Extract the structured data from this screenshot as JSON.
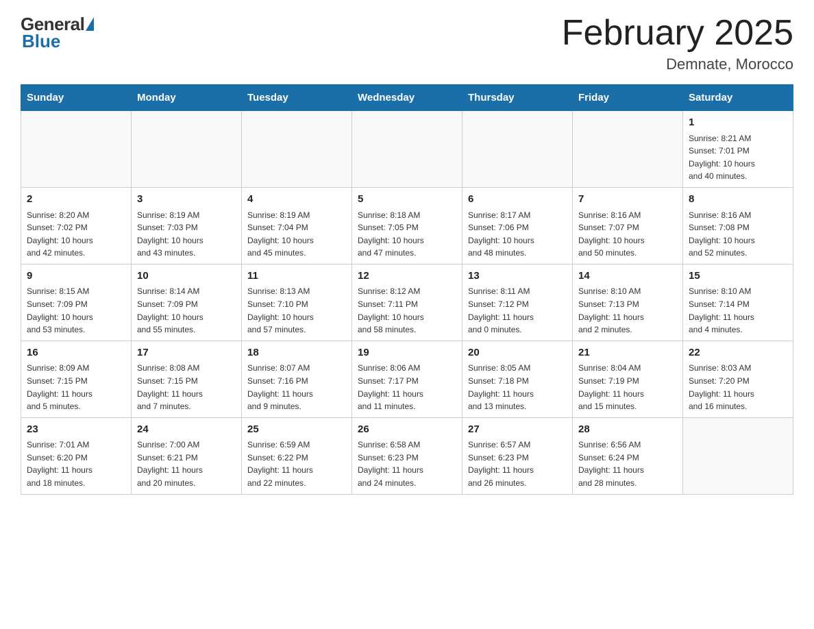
{
  "logo": {
    "general": "General",
    "blue": "Blue"
  },
  "title": "February 2025",
  "subtitle": "Demnate, Morocco",
  "weekdays": [
    "Sunday",
    "Monday",
    "Tuesday",
    "Wednesday",
    "Thursday",
    "Friday",
    "Saturday"
  ],
  "weeks": [
    [
      {
        "day": "",
        "info": ""
      },
      {
        "day": "",
        "info": ""
      },
      {
        "day": "",
        "info": ""
      },
      {
        "day": "",
        "info": ""
      },
      {
        "day": "",
        "info": ""
      },
      {
        "day": "",
        "info": ""
      },
      {
        "day": "1",
        "info": "Sunrise: 8:21 AM\nSunset: 7:01 PM\nDaylight: 10 hours\nand 40 minutes."
      }
    ],
    [
      {
        "day": "2",
        "info": "Sunrise: 8:20 AM\nSunset: 7:02 PM\nDaylight: 10 hours\nand 42 minutes."
      },
      {
        "day": "3",
        "info": "Sunrise: 8:19 AM\nSunset: 7:03 PM\nDaylight: 10 hours\nand 43 minutes."
      },
      {
        "day": "4",
        "info": "Sunrise: 8:19 AM\nSunset: 7:04 PM\nDaylight: 10 hours\nand 45 minutes."
      },
      {
        "day": "5",
        "info": "Sunrise: 8:18 AM\nSunset: 7:05 PM\nDaylight: 10 hours\nand 47 minutes."
      },
      {
        "day": "6",
        "info": "Sunrise: 8:17 AM\nSunset: 7:06 PM\nDaylight: 10 hours\nand 48 minutes."
      },
      {
        "day": "7",
        "info": "Sunrise: 8:16 AM\nSunset: 7:07 PM\nDaylight: 10 hours\nand 50 minutes."
      },
      {
        "day": "8",
        "info": "Sunrise: 8:16 AM\nSunset: 7:08 PM\nDaylight: 10 hours\nand 52 minutes."
      }
    ],
    [
      {
        "day": "9",
        "info": "Sunrise: 8:15 AM\nSunset: 7:09 PM\nDaylight: 10 hours\nand 53 minutes."
      },
      {
        "day": "10",
        "info": "Sunrise: 8:14 AM\nSunset: 7:09 PM\nDaylight: 10 hours\nand 55 minutes."
      },
      {
        "day": "11",
        "info": "Sunrise: 8:13 AM\nSunset: 7:10 PM\nDaylight: 10 hours\nand 57 minutes."
      },
      {
        "day": "12",
        "info": "Sunrise: 8:12 AM\nSunset: 7:11 PM\nDaylight: 10 hours\nand 58 minutes."
      },
      {
        "day": "13",
        "info": "Sunrise: 8:11 AM\nSunset: 7:12 PM\nDaylight: 11 hours\nand 0 minutes."
      },
      {
        "day": "14",
        "info": "Sunrise: 8:10 AM\nSunset: 7:13 PM\nDaylight: 11 hours\nand 2 minutes."
      },
      {
        "day": "15",
        "info": "Sunrise: 8:10 AM\nSunset: 7:14 PM\nDaylight: 11 hours\nand 4 minutes."
      }
    ],
    [
      {
        "day": "16",
        "info": "Sunrise: 8:09 AM\nSunset: 7:15 PM\nDaylight: 11 hours\nand 5 minutes."
      },
      {
        "day": "17",
        "info": "Sunrise: 8:08 AM\nSunset: 7:15 PM\nDaylight: 11 hours\nand 7 minutes."
      },
      {
        "day": "18",
        "info": "Sunrise: 8:07 AM\nSunset: 7:16 PM\nDaylight: 11 hours\nand 9 minutes."
      },
      {
        "day": "19",
        "info": "Sunrise: 8:06 AM\nSunset: 7:17 PM\nDaylight: 11 hours\nand 11 minutes."
      },
      {
        "day": "20",
        "info": "Sunrise: 8:05 AM\nSunset: 7:18 PM\nDaylight: 11 hours\nand 13 minutes."
      },
      {
        "day": "21",
        "info": "Sunrise: 8:04 AM\nSunset: 7:19 PM\nDaylight: 11 hours\nand 15 minutes."
      },
      {
        "day": "22",
        "info": "Sunrise: 8:03 AM\nSunset: 7:20 PM\nDaylight: 11 hours\nand 16 minutes."
      }
    ],
    [
      {
        "day": "23",
        "info": "Sunrise: 7:01 AM\nSunset: 6:20 PM\nDaylight: 11 hours\nand 18 minutes."
      },
      {
        "day": "24",
        "info": "Sunrise: 7:00 AM\nSunset: 6:21 PM\nDaylight: 11 hours\nand 20 minutes."
      },
      {
        "day": "25",
        "info": "Sunrise: 6:59 AM\nSunset: 6:22 PM\nDaylight: 11 hours\nand 22 minutes."
      },
      {
        "day": "26",
        "info": "Sunrise: 6:58 AM\nSunset: 6:23 PM\nDaylight: 11 hours\nand 24 minutes."
      },
      {
        "day": "27",
        "info": "Sunrise: 6:57 AM\nSunset: 6:23 PM\nDaylight: 11 hours\nand 26 minutes."
      },
      {
        "day": "28",
        "info": "Sunrise: 6:56 AM\nSunset: 6:24 PM\nDaylight: 11 hours\nand 28 minutes."
      },
      {
        "day": "",
        "info": ""
      }
    ]
  ]
}
